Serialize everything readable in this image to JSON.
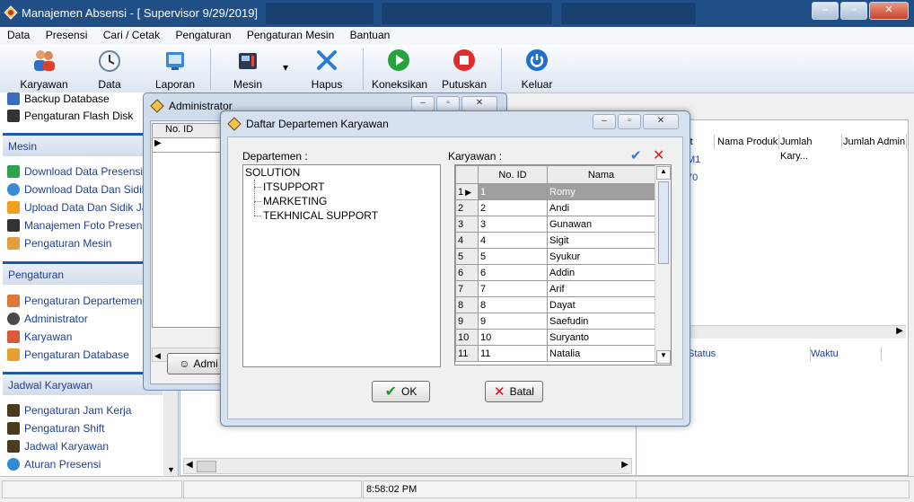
{
  "window": {
    "title": "Manajemen Absensi - [ Supervisor 9/29/2019]"
  },
  "menu": [
    "Data",
    "Presensi",
    "Cari / Cetak",
    "Pengaturan",
    "Pengaturan Mesin",
    "Bantuan"
  ],
  "toolbar": [
    {
      "label": "Karyawan",
      "icon": "users-icon"
    },
    {
      "label": "Data Presensi",
      "icon": "clock-icon"
    },
    {
      "label": "Laporan",
      "icon": "report-icon"
    },
    {
      "label": "Mesin",
      "icon": "machine-icon"
    },
    {
      "label": "Hapus Mesin",
      "icon": "x-icon"
    },
    {
      "label": "Koneksikan",
      "icon": "play-icon"
    },
    {
      "label": "Putuskan",
      "icon": "stop-icon"
    },
    {
      "label": "Keluar",
      "icon": "power-icon"
    }
  ],
  "sidebar": {
    "top_items": [
      "Backup Database",
      "Pengaturan Flash Disk"
    ],
    "mesin": {
      "header": "Mesin",
      "items": [
        "Download Data Presensi",
        "Download Data Dan Sidik J",
        "Upload Data Dan Sidik Jari",
        "Manajemen Foto Presensi",
        "Pengaturan Mesin"
      ]
    },
    "pengaturan": {
      "header": "Pengaturan",
      "items": [
        "Pengaturan Departemen",
        "Administrator",
        "Karyawan",
        "Pengaturan Database"
      ]
    },
    "jadwal": {
      "header": "Jadwal Karyawan",
      "items": [
        "Pengaturan Jam Kerja",
        "Pengaturan Shift",
        "Jadwal Karyawan",
        "Aturan Presensi"
      ]
    }
  },
  "background": {
    "right_cols": [
      "rt",
      "Nama Produk",
      "Jumlah Kary...",
      "Jumlah Admin"
    ],
    "right_rows": [
      "M1",
      "70"
    ],
    "status_cols": [
      "Status",
      "Waktu"
    ]
  },
  "admin_window": {
    "title": "Administrator",
    "col": "No. ID",
    "button": "Admi"
  },
  "dialog": {
    "title": "Daftar Departemen Karyawan",
    "dept_label": "Departemen :",
    "employee_label": "Karyawan :",
    "tree_root": "SOLUTION",
    "tree_children": [
      "ITSUPPORT",
      "MARKETING",
      "TEKHNICAL SUPPORT"
    ],
    "grid_headers": [
      "No. ID",
      "Nama"
    ],
    "rows": [
      {
        "n": "1",
        "id": "1",
        "name": "Romy"
      },
      {
        "n": "2",
        "id": "2",
        "name": "Andi"
      },
      {
        "n": "3",
        "id": "3",
        "name": "Gunawan"
      },
      {
        "n": "4",
        "id": "4",
        "name": "Sigit"
      },
      {
        "n": "5",
        "id": "5",
        "name": "Syukur"
      },
      {
        "n": "6",
        "id": "6",
        "name": "Addin"
      },
      {
        "n": "7",
        "id": "7",
        "name": "Arif"
      },
      {
        "n": "8",
        "id": "8",
        "name": "Dayat"
      },
      {
        "n": "9",
        "id": "9",
        "name": "Saefudin"
      },
      {
        "n": "10",
        "id": "10",
        "name": "Suryanto"
      },
      {
        "n": "11",
        "id": "11",
        "name": "Natalia"
      }
    ],
    "ok_label": "OK",
    "cancel_label": "Batal"
  },
  "status": {
    "time": "8:58:02 PM"
  },
  "colors": {
    "title_bar": "#1f4f86",
    "accent_blue": "#1e58a8",
    "link_blue": "#1e3f95",
    "ok_green": "#1a9a2a",
    "cancel_red": "#cc1111"
  }
}
